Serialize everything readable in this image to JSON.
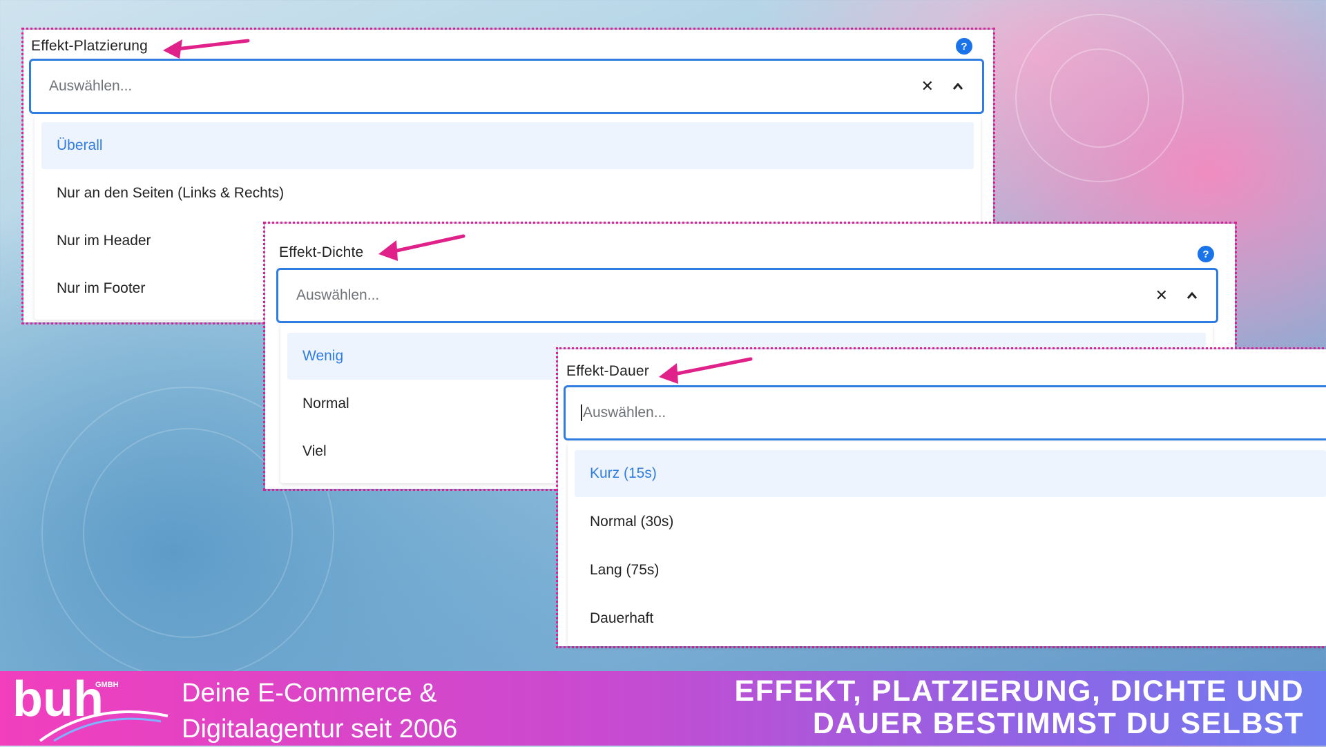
{
  "colors": {
    "accent": "#2f7de1",
    "highlight": "#e0218a",
    "footer_start": "#f13fbd",
    "footer_end": "#6f7ef0"
  },
  "placement": {
    "label": "Effekt-Platzierung",
    "placeholder": "Auswählen...",
    "options": [
      "Überall",
      "Nur an den Seiten (Links & Rechts)",
      "Nur im Header",
      "Nur im Footer"
    ],
    "active_option": "Überall"
  },
  "density": {
    "label": "Effekt-Dichte",
    "placeholder": "Auswählen...",
    "options": [
      "Wenig",
      "Normal",
      "Viel"
    ],
    "active_option": "Wenig"
  },
  "duration": {
    "label": "Effekt-Dauer",
    "placeholder": "Auswählen...",
    "options": [
      "Kurz (15s)",
      "Normal (30s)",
      "Lang (75s)",
      "Dauerhaft"
    ],
    "active_option": "Kurz (15s)"
  },
  "footer": {
    "logo_text": "buh",
    "logo_suffix": "GMBH",
    "tagline_line1": "Deine E-Commerce &",
    "tagline_line2": "Digitalagentur seit 2006",
    "headline_line1": "EFFEKT, PLATZIERUNG, DICHTE UND",
    "headline_line2": "DAUER BESTIMMST DU SELBST"
  }
}
